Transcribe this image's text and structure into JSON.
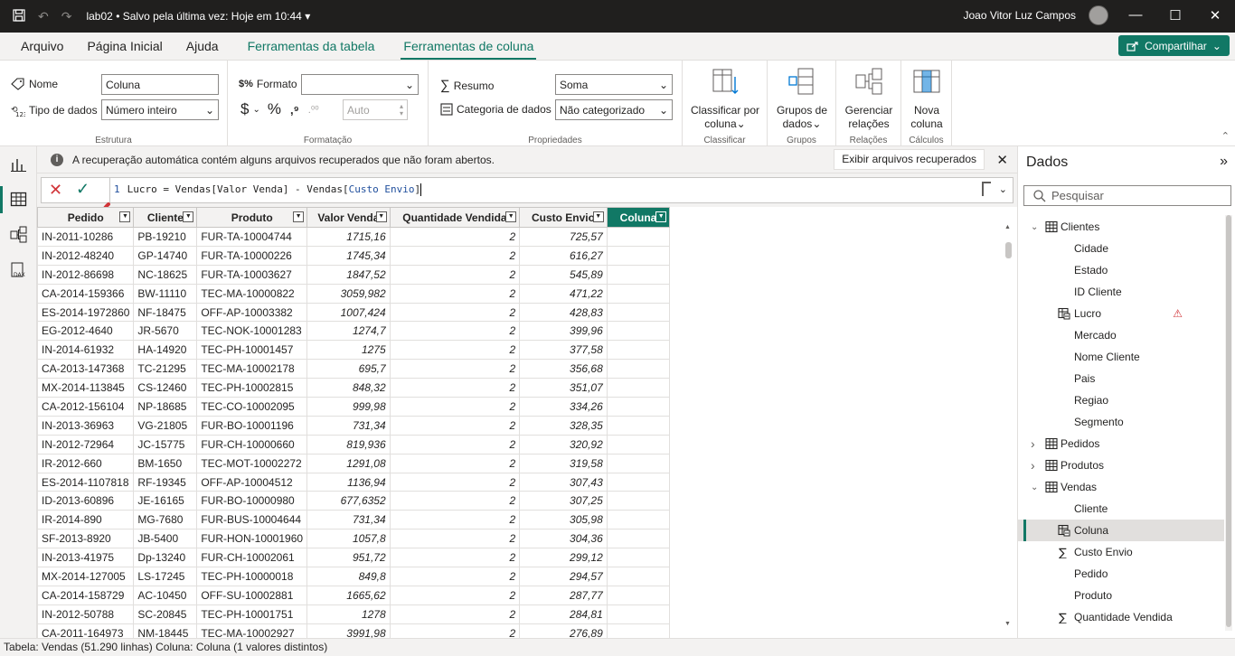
{
  "titlebar": {
    "doc_name": "lab02",
    "save_status": "Salvo pela última vez: Hoje em 10:44",
    "user_name": "Joao Vitor Luz Campos"
  },
  "tabs": [
    {
      "label": "Arquivo"
    },
    {
      "label": "Página Inicial"
    },
    {
      "label": "Ajuda"
    },
    {
      "label": "Ferramentas da tabela"
    },
    {
      "label": "Ferramentas de coluna"
    }
  ],
  "share_label": "Compartilhar",
  "ribbon": {
    "estrutura": {
      "label": "Estrutura",
      "name_label": "Nome",
      "name_value": "Coluna",
      "type_label": "Tipo de dados",
      "type_value": "Número inteiro"
    },
    "formatacao": {
      "label": "Formatação",
      "format_label": "Formato",
      "format_value": "",
      "auto_value": "Auto"
    },
    "propriedades": {
      "label": "Propriedades",
      "summary_label": "Resumo",
      "summary_value": "Soma",
      "category_label": "Categoria de dados",
      "category_value": "Não categorizado"
    },
    "classificar": {
      "label": "Classificar",
      "btn1": "Classificar por",
      "btn2": "coluna"
    },
    "grupos": {
      "label": "Grupos",
      "btn1": "Grupos de",
      "btn2": "dados"
    },
    "relacoes": {
      "label": "Relações",
      "btn1": "Gerenciar",
      "btn2": "relações"
    },
    "calculos": {
      "label": "Cálculos",
      "btn1": "Nova",
      "btn2": "coluna"
    }
  },
  "notice": {
    "message": "A recuperação automática contém alguns arquivos recuperados que não foram abertos.",
    "button": "Exibir arquivos recuperados"
  },
  "formula": {
    "line": "1",
    "text_before": "Lucro = Vendas[Valor Venda] - Vendas[",
    "text_after": "Custo Envio",
    "text_end": "]"
  },
  "table": {
    "columns": [
      "Pedido",
      "Cliente",
      "Produto",
      "Valor Venda",
      "Quantidade Vendida",
      "Custo Envio",
      "Coluna"
    ],
    "rows": [
      [
        "IN-2011-10286",
        "PB-19210",
        "FUR-TA-10004744",
        "1715,16",
        "2",
        "725,57",
        ""
      ],
      [
        "IN-2012-48240",
        "GP-14740",
        "FUR-TA-10000226",
        "1745,34",
        "2",
        "616,27",
        ""
      ],
      [
        "IN-2012-86698",
        "NC-18625",
        "FUR-TA-10003627",
        "1847,52",
        "2",
        "545,89",
        ""
      ],
      [
        "CA-2014-159366",
        "BW-11110",
        "TEC-MA-10000822",
        "3059,982",
        "2",
        "471,22",
        ""
      ],
      [
        "ES-2014-1972860",
        "NF-18475",
        "OFF-AP-10003382",
        "1007,424",
        "2",
        "428,83",
        ""
      ],
      [
        "EG-2012-4640",
        "JR-5670",
        "TEC-NOK-10001283",
        "1274,7",
        "2",
        "399,96",
        ""
      ],
      [
        "IN-2014-61932",
        "HA-14920",
        "TEC-PH-10001457",
        "1275",
        "2",
        "377,58",
        ""
      ],
      [
        "CA-2013-147368",
        "TC-21295",
        "TEC-MA-10002178",
        "695,7",
        "2",
        "356,68",
        ""
      ],
      [
        "MX-2014-113845",
        "CS-12460",
        "TEC-PH-10002815",
        "848,32",
        "2",
        "351,07",
        ""
      ],
      [
        "CA-2012-156104",
        "NP-18685",
        "TEC-CO-10002095",
        "999,98",
        "2",
        "334,26",
        ""
      ],
      [
        "IN-2013-36963",
        "VG-21805",
        "FUR-BO-10001196",
        "731,34",
        "2",
        "328,35",
        ""
      ],
      [
        "IN-2012-72964",
        "JC-15775",
        "FUR-CH-10000660",
        "819,936",
        "2",
        "320,92",
        ""
      ],
      [
        "IR-2012-660",
        "BM-1650",
        "TEC-MOT-10002272",
        "1291,08",
        "2",
        "319,58",
        ""
      ],
      [
        "ES-2014-1107818",
        "RF-19345",
        "OFF-AP-10004512",
        "1136,94",
        "2",
        "307,43",
        ""
      ],
      [
        "ID-2013-60896",
        "JE-16165",
        "FUR-BO-10000980",
        "677,6352",
        "2",
        "307,25",
        ""
      ],
      [
        "IR-2014-890",
        "MG-7680",
        "FUR-BUS-10004644",
        "731,34",
        "2",
        "305,98",
        ""
      ],
      [
        "SF-2013-8920",
        "JB-5400",
        "FUR-HON-10001960",
        "1057,8",
        "2",
        "304,36",
        ""
      ],
      [
        "IN-2013-41975",
        "Dp-13240",
        "FUR-CH-10002061",
        "951,72",
        "2",
        "299,12",
        ""
      ],
      [
        "MX-2014-127005",
        "LS-17245",
        "TEC-PH-10000018",
        "849,8",
        "2",
        "294,57",
        ""
      ],
      [
        "CA-2014-158729",
        "AC-10450",
        "OFF-SU-10002881",
        "1665,62",
        "2",
        "287,77",
        ""
      ],
      [
        "IN-2012-50788",
        "SC-20845",
        "TEC-PH-10001751",
        "1278",
        "2",
        "284,81",
        ""
      ],
      [
        "CA-2011-164973",
        "NM-18445",
        "TEC-MA-10002927",
        "3991,98",
        "2",
        "276,89",
        ""
      ]
    ]
  },
  "pane": {
    "title": "Dados",
    "search_placeholder": "Pesquisar",
    "items": [
      {
        "label": "Clientes",
        "kind": "table",
        "level": 0,
        "expanded": true
      },
      {
        "label": "Cidade",
        "kind": "field",
        "level": 1
      },
      {
        "label": "Estado",
        "kind": "field",
        "level": 1
      },
      {
        "label": "ID Cliente",
        "kind": "field",
        "level": 1
      },
      {
        "label": "Lucro",
        "kind": "calc",
        "level": 1,
        "warning": true
      },
      {
        "label": "Mercado",
        "kind": "field",
        "level": 1
      },
      {
        "label": "Nome Cliente",
        "kind": "field",
        "level": 1
      },
      {
        "label": "Pais",
        "kind": "field",
        "level": 1
      },
      {
        "label": "Regiao",
        "kind": "field",
        "level": 1
      },
      {
        "label": "Segmento",
        "kind": "field",
        "level": 1
      },
      {
        "label": "Pedidos",
        "kind": "table",
        "level": 0,
        "expanded": false
      },
      {
        "label": "Produtos",
        "kind": "table",
        "level": 0,
        "expanded": false
      },
      {
        "label": "Vendas",
        "kind": "table",
        "level": 0,
        "expanded": true
      },
      {
        "label": "Cliente",
        "kind": "field",
        "level": 1
      },
      {
        "label": "Coluna",
        "kind": "calc",
        "level": 1,
        "selected": true
      },
      {
        "label": "Custo Envio",
        "kind": "sum",
        "level": 1
      },
      {
        "label": "Pedido",
        "kind": "field",
        "level": 1
      },
      {
        "label": "Produto",
        "kind": "field",
        "level": 1
      },
      {
        "label": "Quantidade Vendida",
        "kind": "sum",
        "level": 1
      }
    ]
  },
  "status": "Tabela: Vendas (51.290 linhas) Coluna: Coluna (1 valores distintos)",
  "colors": {
    "accent": "#117865",
    "error": "#d13438"
  }
}
